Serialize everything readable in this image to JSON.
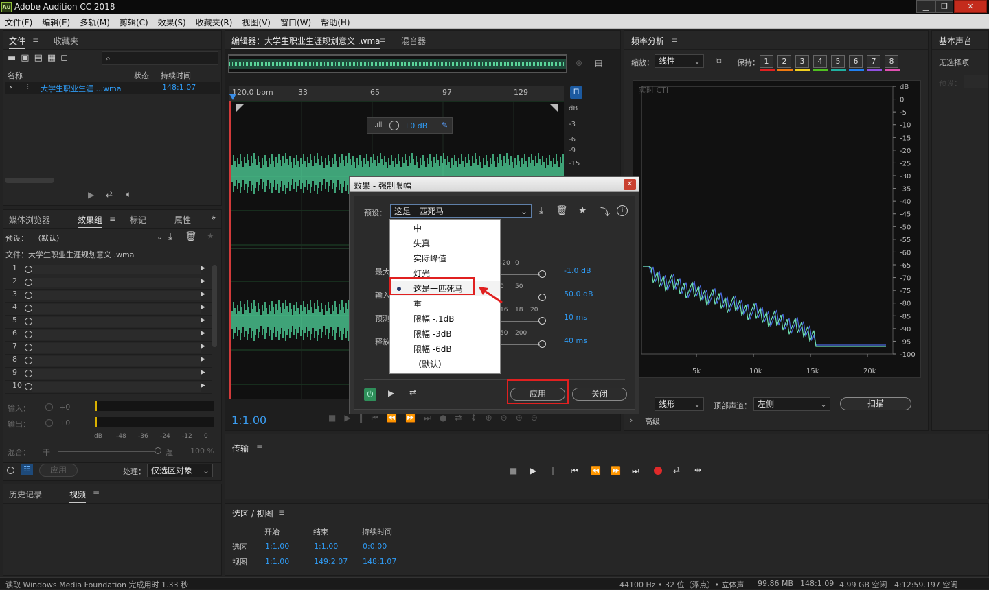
{
  "window": {
    "app_icon": "Au",
    "title": "Adobe Audition CC 2018",
    "min": "▁",
    "max": "❐",
    "close": "✕"
  },
  "menu": [
    "文件(F)",
    "编辑(E)",
    "多轨(M)",
    "剪辑(C)",
    "效果(S)",
    "收藏夹(R)",
    "视图(V)",
    "窗口(W)",
    "帮助(H)"
  ],
  "files_panel": {
    "tabs": [
      "文件",
      "收藏夹"
    ],
    "col_name": "名称",
    "col_status": "状态",
    "col_duration": "持续时间",
    "file_name": "大学生职业生涯 ...wma",
    "file_duration": "148:1.07"
  },
  "effects_panel": {
    "tabs": [
      "媒体浏览器",
      "效果组",
      "标记",
      "属性"
    ],
    "preset_label": "预设：",
    "preset_value": "（默认）",
    "file_label": "文件：大学生职业生涯规划意义 .wma",
    "slots": [
      "1",
      "2",
      "3",
      "4",
      "5",
      "6",
      "7",
      "8",
      "9",
      "10"
    ],
    "input_label": "输入：",
    "output_label": "输出：",
    "level_zero": "+0",
    "meter_ticks": [
      "dB",
      "-48",
      "-36",
      "-24",
      "-12",
      "0"
    ],
    "mix_label": "混合：",
    "mix_dry": "干",
    "mix_wet": "湿",
    "mix_pct": "100 %",
    "apply": "应用",
    "process_label": "处理：",
    "process_value": "仅选区对象"
  },
  "history_panel": {
    "tabs": [
      "历史记录",
      "视频"
    ]
  },
  "editor": {
    "tab_title": "编辑器：大学生职业生涯规划意义 .wma",
    "tab_mixer": "混音器",
    "ruler": [
      "120.0 bpm",
      "33",
      "65",
      "97",
      "129"
    ],
    "db_scale": [
      "dB",
      "-3",
      "-6",
      "-9",
      "-15"
    ],
    "hud_gain": "+0 dB",
    "timecode": "1:1.00"
  },
  "effect_dialog": {
    "title": "效果 - 强制限幅",
    "preset_label": "预设：",
    "preset_value": "这是一匹死马",
    "dropdown_items": [
      "中",
      "失真",
      "实际峰值",
      "灯光",
      "这是一匹死马",
      "重",
      "限幅 -.1dB",
      "限幅 -3dB",
      "限幅 -6dB",
      "（默认）"
    ],
    "selected_index": 4,
    "params": [
      {
        "label": "最大",
        "ticks": [
          "-20",
          "0"
        ],
        "value": "-1.0 dB"
      },
      {
        "label": "输入",
        "ticks": [
          "0",
          "50"
        ],
        "value": "50.0 dB"
      },
      {
        "label": "预测",
        "ticks": [
          "16",
          "18",
          "20"
        ],
        "value": "10 ms"
      },
      {
        "label": "释放",
        "ticks": [
          "50",
          "200"
        ],
        "value": "40 ms"
      }
    ],
    "apply": "应用",
    "close": "关闭"
  },
  "freq_panel": {
    "title": "频率分析",
    "scale_label": "缩放：",
    "scale_value": "线性",
    "hold_label": "保持：",
    "hold_buttons": [
      "1",
      "2",
      "3",
      "4",
      "5",
      "6",
      "7",
      "8"
    ],
    "hold_colors": [
      "#e02020",
      "#f07a10",
      "#f0d020",
      "#50c020",
      "#20b0a0",
      "#2080f0",
      "#9050e0",
      "#e050b0"
    ],
    "cursor_label": "实时 CTI",
    "db_ticks": [
      "dB",
      "0",
      "-5",
      "-10",
      "-15",
      "-20",
      "-25",
      "-30",
      "-35",
      "-40",
      "-45",
      "-50",
      "-55",
      "-60",
      "-65",
      "-70",
      "-75",
      "-80",
      "-85",
      "-90",
      "-95",
      "-100"
    ],
    "hz_ticks": [
      "5k",
      "10k",
      "15k",
      "20k"
    ],
    "graph_label": "示：",
    "graph_value": "线形",
    "channel_label": "顶部声道：",
    "channel_value": "左侧",
    "scan": "扫描",
    "advanced": "高级"
  },
  "essential_panel": {
    "title": "基本声音",
    "empty": "无选择项",
    "preset": "预设："
  },
  "transport": {
    "title": "传输"
  },
  "selection_panel": {
    "title": "选区 / 视图",
    "cols": [
      "开始",
      "结束",
      "持续时间"
    ],
    "rows": [
      {
        "label": "选区",
        "start": "1:1.00",
        "end": "1:1.00",
        "dur": "0:0.00"
      },
      {
        "label": "视图",
        "start": "1:1.00",
        "end": "149:2.07",
        "dur": "148:1.07"
      }
    ]
  },
  "status": {
    "left": "读取 Windows Media Foundation 完成用时 1.33 秒",
    "rate": "44100 Hz • 32 位（浮点）• 立体声",
    "size": "99.86 MB",
    "dur": "148:1.09",
    "free": "4.99 GB 空闲",
    "time_free": "4:12:59.197 空闲"
  }
}
